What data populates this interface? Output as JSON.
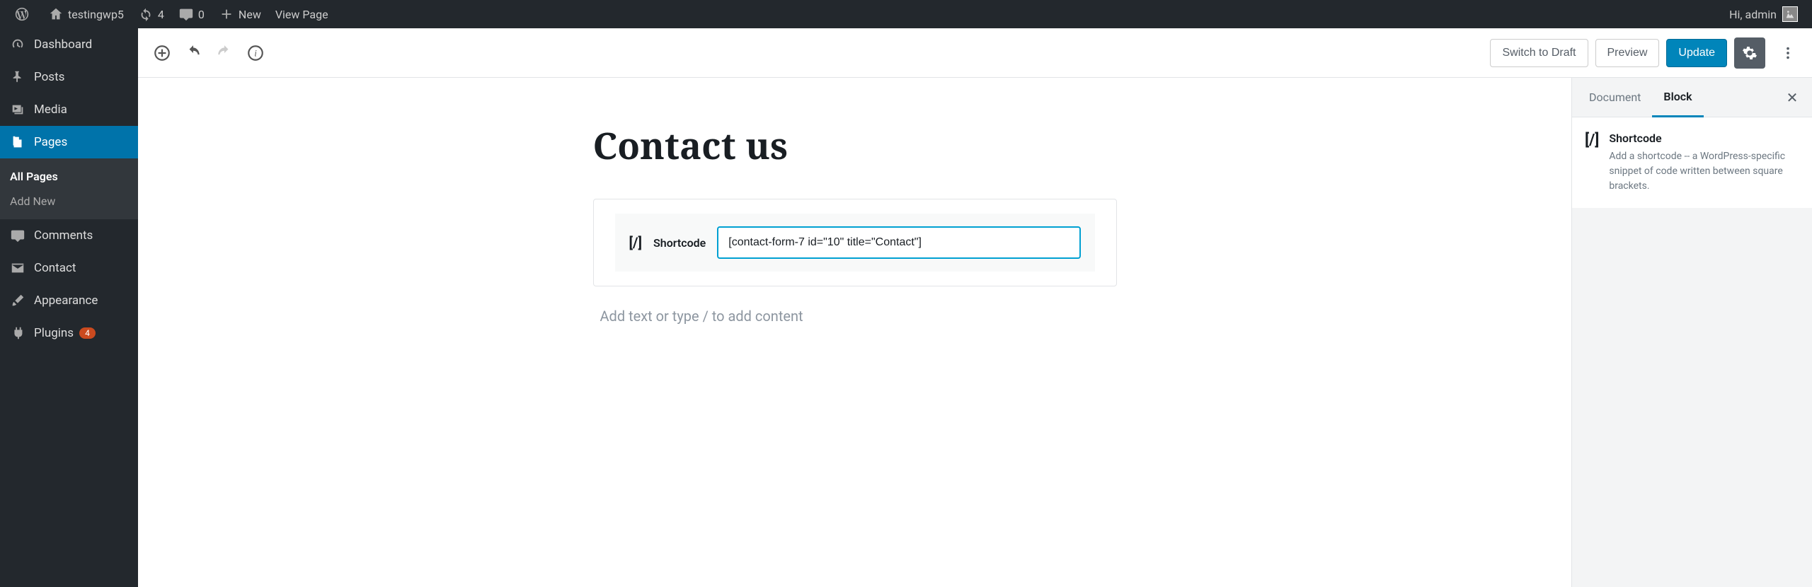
{
  "adminbar": {
    "site_name": "testingwp5",
    "updates_count": "4",
    "comments_count": "0",
    "new_label": "New",
    "view_page_label": "View Page",
    "greeting": "Hi, admin"
  },
  "sidebar": {
    "items": [
      {
        "id": "dashboard",
        "label": "Dashboard",
        "icon": "gauge"
      },
      {
        "id": "posts",
        "label": "Posts",
        "icon": "pin"
      },
      {
        "id": "media",
        "label": "Media",
        "icon": "media"
      },
      {
        "id": "pages",
        "label": "Pages",
        "icon": "pages",
        "active": true,
        "submenu": [
          {
            "label": "All Pages",
            "current": true
          },
          {
            "label": "Add New"
          }
        ]
      },
      {
        "id": "comments",
        "label": "Comments",
        "icon": "comment"
      },
      {
        "id": "contact",
        "label": "Contact",
        "icon": "mail"
      },
      {
        "id": "appearance",
        "label": "Appearance",
        "icon": "brush"
      },
      {
        "id": "plugins",
        "label": "Plugins",
        "icon": "plug",
        "badge": "4"
      }
    ]
  },
  "editor": {
    "switch_draft_label": "Switch to Draft",
    "preview_label": "Preview",
    "update_label": "Update",
    "page_title": "Contact us",
    "shortcode_label": "Shortcode",
    "shortcode_value": "[contact-form-7 id=\"10\" title=\"Contact\"]",
    "placeholder": "Add text or type / to add content"
  },
  "settings": {
    "tab_document": "Document",
    "tab_block": "Block",
    "block_panel_title": "Shortcode",
    "block_panel_desc": "Add a shortcode -- a WordPress-specific snippet of code written between square brackets."
  }
}
